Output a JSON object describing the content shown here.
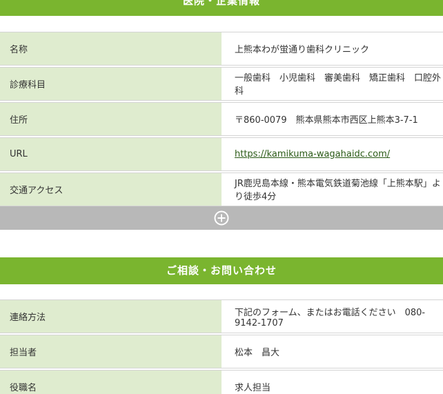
{
  "company_section": {
    "title": "医院・企業情報",
    "rows": [
      {
        "label": "名称",
        "value": "上熊本わが蛍通り歯科クリニック"
      },
      {
        "label": "診療科目",
        "value": "一般歯科　小児歯科　審美歯科　矯正歯科　口腔外科"
      },
      {
        "label": "住所",
        "value": "〒860-0079　熊本県熊本市西区上熊本3-7-1"
      },
      {
        "label": "URL",
        "value": "https://kamikuma-wagahaidc.com/"
      },
      {
        "label": "交通アクセス",
        "value": "JR鹿児島本線・熊本電気鉄道菊池線「上熊本駅」より徒歩4分"
      }
    ],
    "expand_icon": "plus-circle-icon"
  },
  "contact_section": {
    "title": "ご相談・お問い合わせ",
    "rows": [
      {
        "label": "連絡方法",
        "value": "下記のフォーム、またはお電話ください　080-9142-1707"
      },
      {
        "label": "担当者",
        "value": "松本　昌大"
      },
      {
        "label": "役職名",
        "value": "求人担当"
      }
    ]
  },
  "colors": {
    "header_green": "#7ab52f",
    "label_bg": "#dfeccf",
    "expand_bar": "#b8b8b8"
  }
}
